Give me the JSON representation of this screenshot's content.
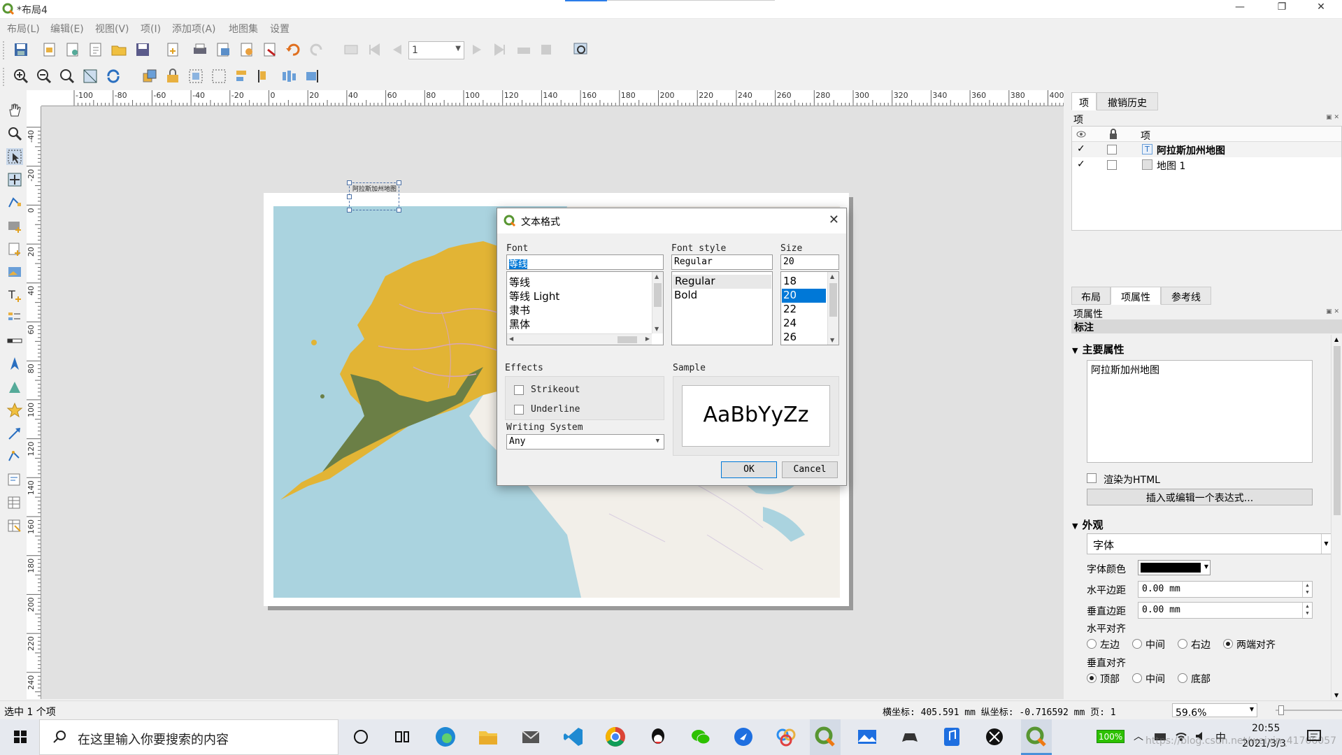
{
  "window": {
    "title": "*布局4",
    "min": "—",
    "max": "❐",
    "close": "✕"
  },
  "menu": [
    "布局(L)",
    "编辑(E)",
    "视图(V)",
    "项(I)",
    "添加项(A)",
    "地图集",
    "设置"
  ],
  "toolbar": {
    "page_number": "1"
  },
  "ruler": {
    "h_labels": [
      "-100",
      "-80",
      "-60",
      "-40",
      "-20",
      "0",
      "20",
      "40",
      "60",
      "80",
      "100",
      "120",
      "140",
      "160",
      "180",
      "200",
      "220",
      "240",
      "260",
      "280",
      "300",
      "320",
      "340",
      "360",
      "380",
      "400"
    ],
    "v_labels": [
      "-40",
      "-20",
      "0",
      "20",
      "40",
      "60",
      "80",
      "100",
      "120",
      "140",
      "160",
      "180",
      "200",
      "220",
      "240"
    ]
  },
  "map": {
    "label_on_map": "阿拉斯加州地图"
  },
  "dialog": {
    "title": "文本格式",
    "font_label": "Font",
    "font_value": "等线",
    "font_items": [
      "等线",
      "等线 Light",
      "隶书",
      "黑体"
    ],
    "style_label": "Font style",
    "style_value": "Regular",
    "style_items": [
      "Regular",
      "Bold"
    ],
    "size_label": "Size",
    "size_value": "20",
    "size_items": [
      "18",
      "20",
      "22",
      "24",
      "26"
    ],
    "effects_label": "Effects",
    "strikeout": "Strikeout",
    "underline": "Underline",
    "sample_label": "Sample",
    "sample_text": "AaBbYyZz",
    "writing_label": "Writing System",
    "writing_value": "Any",
    "ok": "OK",
    "cancel": "Cancel"
  },
  "panel": {
    "tabs": [
      "项",
      "撤销历史"
    ],
    "items_title": "项",
    "items_header": "项",
    "items": [
      {
        "name": "阿拉斯加州地图",
        "checked": true,
        "bold": true
      },
      {
        "name": "地图 1",
        "checked": true,
        "bold": false
      }
    ],
    "tabs2": [
      "布局",
      "项属性",
      "参考线"
    ],
    "props_title": "项属性",
    "props_sub": "标注",
    "main_props": "主要属性",
    "label_text": "阿拉斯加州地图",
    "render_html": "渲染为HTML",
    "insert_expr": "插入或编辑一个表达式...",
    "appearance": "外观",
    "font_btn": "字体",
    "font_color": "字体颜色",
    "h_margin_label": "水平边距",
    "h_margin": "0.00 mm",
    "v_margin_label": "垂直边距",
    "v_margin": "0.00 mm",
    "h_align_label": "水平对齐",
    "h_align": [
      "左边",
      "中间",
      "右边",
      "两端对齐"
    ],
    "v_align_label": "垂直对齐",
    "v_align": [
      "顶部",
      "中间",
      "底部"
    ]
  },
  "status": {
    "selected": "选中 1 个项",
    "coords": "横坐标: 405.591 mm 纵坐标: -0.716592 mm 页: 1",
    "zoom": "59.6%"
  },
  "taskbar": {
    "search_placeholder": "在这里输入你要搜索的内容",
    "battery": "100%",
    "ime": "中",
    "time": "20:55",
    "date": "2021/3/3",
    "watermark": "https://blog.csdn.net/weixin_41706057"
  },
  "colors": {
    "accent": "#0078d7",
    "land": "#e2b435",
    "water": "#aad3df",
    "qgis_green": "#589632"
  }
}
